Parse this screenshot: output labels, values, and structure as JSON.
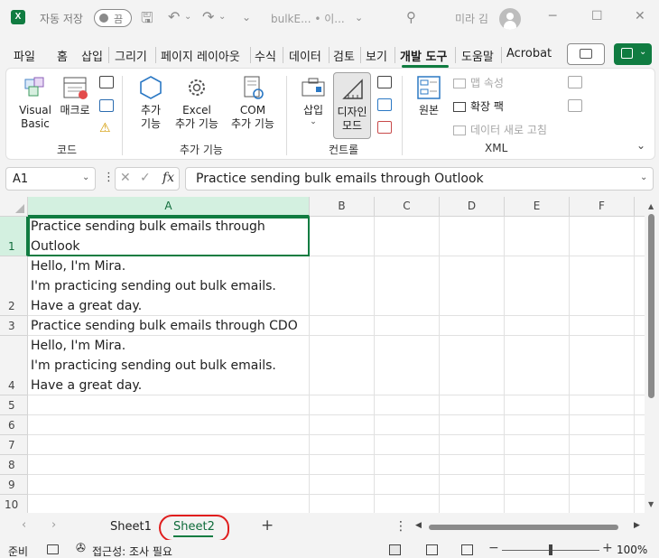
{
  "titlebar": {
    "app_icon": "X",
    "autosave_label": "자동 저장",
    "autosave_state": "끔",
    "filename": "bulkE... • 이...",
    "user_name": "미라 김"
  },
  "tabs": [
    "파일",
    "홈",
    "삽입",
    "그리기",
    "페이지 레이아웃",
    "수식",
    "데이터",
    "검토",
    "보기",
    "개발 도구",
    "도움말",
    "Acrobat"
  ],
  "active_tab": "개발 도구",
  "ribbon": {
    "code": {
      "visual_basic": "Visual\nBasic",
      "macro": "매크로",
      "group_label": "코드"
    },
    "addins": {
      "addins": "추가\n기능",
      "excel_addins": "Excel\n추가 기능",
      "com_addins": "COM\n추가 기능",
      "group_label": "추가 기능"
    },
    "controls": {
      "insert": "삽입",
      "design_mode": "디자인\n모드",
      "group_label": "컨트롤"
    },
    "xml": {
      "source": "원본",
      "map_properties": "맵 속성",
      "expansion_packs": "확장 팩",
      "refresh_data": "데이터 새로 고침",
      "group_label": "XML"
    }
  },
  "formula_bar": {
    "name_box": "A1",
    "fx": "fx",
    "content": "Practice sending bulk emails through Outlook"
  },
  "grid": {
    "columns": [
      "A",
      "B",
      "C",
      "D",
      "E",
      "F"
    ],
    "rows": [
      "1",
      "2",
      "3",
      "4",
      "5",
      "6",
      "7",
      "8",
      "9",
      "10"
    ],
    "cells": {
      "A1": "Practice sending bulk emails through\nOutlook",
      "A2": "Hello, I'm Mira.\nI'm practicing sending out bulk emails.\nHave a great day.",
      "A3": "Practice sending bulk emails through CDO",
      "A4": "Hello, I'm Mira.\nI'm practicing sending out bulk emails.\nHave a great day."
    }
  },
  "sheets": [
    "Sheet1",
    "Sheet2"
  ],
  "active_sheet": "Sheet2",
  "status": {
    "ready": "준비",
    "accessibility": "접근성: 조사 필요",
    "zoom": "100%",
    "zoom_fraction": 0.5
  },
  "colors": {
    "accent": "#107c41",
    "annotation": "#e01e1e"
  }
}
